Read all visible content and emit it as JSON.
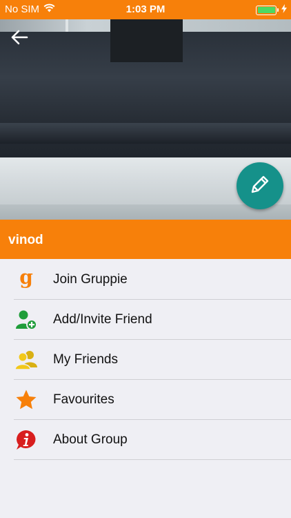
{
  "status_bar": {
    "carrier": "No SIM",
    "time": "1:03 PM",
    "wifi_icon": "wifi-icon",
    "battery_icon": "battery-icon",
    "charging_icon": "bolt-icon"
  },
  "header": {
    "back_icon": "arrow-left-icon",
    "edit_icon": "pencil-icon",
    "accent_color": "#f7800a",
    "fab_color": "#15918a"
  },
  "group": {
    "name": "vinod"
  },
  "menu": {
    "items": [
      {
        "label": "Join Gruppie",
        "icon": "gruppie-g-icon"
      },
      {
        "label": "Add/Invite Friend",
        "icon": "add-friend-icon"
      },
      {
        "label": "My Friends",
        "icon": "friends-icon"
      },
      {
        "label": "Favourites",
        "icon": "star-icon"
      },
      {
        "label": "About Group",
        "icon": "info-icon"
      }
    ]
  }
}
